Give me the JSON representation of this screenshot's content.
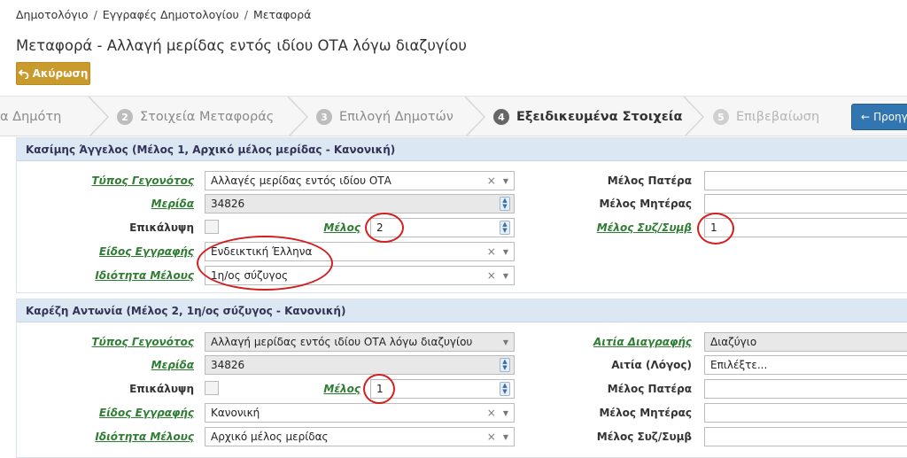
{
  "breadcrumb": [
    "Δημοτολόγιο",
    "Εγγραφές Δημοτολογίου",
    "Μεταφορά"
  ],
  "page_title": "Μεταφορά - Αλλαγή μερίδας εντός ιδίου ΟΤΑ λόγω διαζυγίου",
  "cancel_label": "Ακύρωση",
  "wizard": {
    "steps": [
      {
        "num": "",
        "label": "α Δημότη"
      },
      {
        "num": "2",
        "label": "Στοιχεία Μεταφοράς"
      },
      {
        "num": "3",
        "label": "Επιλογή Δημοτών"
      },
      {
        "num": "4",
        "label": "Εξειδικευμένα Στοιχεία"
      },
      {
        "num": "5",
        "label": "Επιβεβαίωση"
      }
    ],
    "active_step": "4",
    "next_label": "Προηγ"
  },
  "panel1": {
    "title": "Κασίμης Άγγελος (Μέλος 1, Αρχικό μέλος μερίδας - Κανονική)",
    "labels": {
      "event_type": "Τύπος Γεγονότος",
      "merida": "Μερίδα",
      "epikalypsi": "Επικάλυψη",
      "melos": "Μέλος",
      "eidos": "Είδος Εγγραφής",
      "idiotita": "Ιδιότητα Μέλους",
      "melos_patera": "Μέλος Πατέρα",
      "melos_miteras": "Μέλος Μητέρας",
      "melos_syz": "Μέλος Συζ/Συμβ"
    },
    "values": {
      "event_type": "Αλλαγές μερίδας εντός ιδίου ΟΤΑ",
      "merida": "34826",
      "melos": "2",
      "eidos": "Ενδεικτική Έλληνα",
      "idiotita": "1η/ος σύζυγος",
      "melos_patera": "",
      "melos_miteras": "",
      "melos_syz": "1"
    }
  },
  "panel2": {
    "title": "Καρέζη Αντωνία (Μέλος 2, 1η/ος σύζυγος - Κανονική)",
    "labels": {
      "event_type": "Τύπος Γεγονότος",
      "merida": "Μερίδα",
      "epikalypsi": "Επικάλυψη",
      "melos": "Μέλος",
      "eidos": "Είδος Εγγραφής",
      "idiotita": "Ιδιότητα Μέλους",
      "aitia_diagrafis": "Αιτία Διαγραφής",
      "aitia_logos": "Αιτία (Λόγος)",
      "melos_patera": "Μέλος Πατέρα",
      "melos_miteras": "Μέλος Μητέρας",
      "melos_syz": "Μέλος Συζ/Συμβ"
    },
    "values": {
      "event_type": "Αλλαγή μερίδας εντός ιδίου ΟΤΑ λόγω διαζυγίου",
      "merida": "34826",
      "melos": "1",
      "eidos": "Κανονική",
      "idiotita": "Αρχικό μέλος μερίδας",
      "aitia_diagrafis": "Διαζύγιο",
      "aitia_logos": "Επιλέξτε...",
      "melos_patera": "",
      "melos_miteras": "",
      "melos_syz": ""
    }
  },
  "select_controls": {
    "clear": "×",
    "caret": "▼"
  },
  "colors": {
    "required_label": "#2e7d32",
    "annotation_circle": "#d21f1f",
    "cancel_button": "#c99a2c",
    "next_button": "#3276b1",
    "panel_header": "#dbe8f3"
  }
}
